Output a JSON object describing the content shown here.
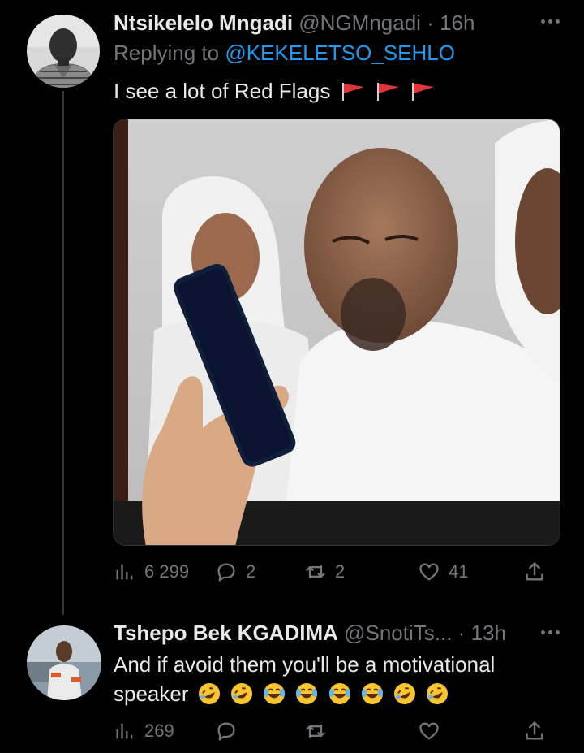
{
  "tweets": [
    {
      "name": "Ntsikelelo Mngadi",
      "handle": "@NGMngadi",
      "separator": "·",
      "time": "16h",
      "replying_prefix": "Replying to",
      "replying_to": "@KEKELETSO_SEHLO",
      "text": "I see a lot of Red Flags",
      "text_emojis": [
        "red-flag",
        "red-flag",
        "red-flag"
      ],
      "media": "photo of a man in white looking at a phone screen",
      "actions": {
        "views": "6 299",
        "replies": "2",
        "retweets": "2",
        "likes": "41"
      }
    },
    {
      "name": "Tshepo Bek KGADIMA",
      "handle": "@SnotiTs...",
      "separator": "·",
      "time": "13h",
      "text": "And if avoid them you'll be a motivational speaker",
      "text_emojis": [
        "rofl",
        "rofl",
        "joy",
        "joy",
        "joy",
        "joy",
        "rofl",
        "rofl"
      ],
      "actions": {
        "views": "269",
        "replies": "",
        "retweets": "",
        "likes": ""
      }
    }
  ],
  "colors": {
    "background": "#000000",
    "text": "#e7e9ea",
    "secondary": "#71767b",
    "link": "#1d9bf0",
    "flag": "#e0333a"
  },
  "icons": [
    "views-icon",
    "reply-icon",
    "retweet-icon",
    "like-icon",
    "share-icon",
    "more-icon"
  ]
}
